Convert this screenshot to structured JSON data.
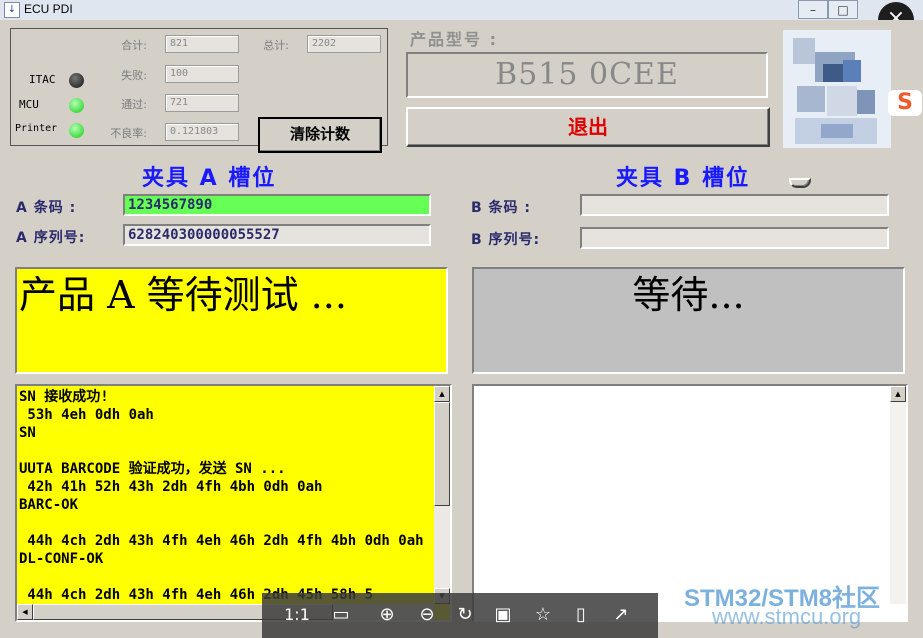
{
  "window": {
    "title": "ECU PDI",
    "close_glyph": "×"
  },
  "indicators": [
    {
      "label": "ITAC",
      "state": "off"
    },
    {
      "label": "MCU",
      "state": "on"
    },
    {
      "label": "Printer",
      "state": "on"
    }
  ],
  "counters": {
    "total_ok_label": "合计:",
    "total_ok_value": "821",
    "grand_total_label": "总计:",
    "grand_total_value": "2202",
    "fail_label": "失败:",
    "fail_value": "100",
    "pass_label": "通过:",
    "pass_value": "721",
    "defect_rate_label": "不良率:",
    "defect_rate_value": "0.121803",
    "clear_button": "清除计数"
  },
  "product": {
    "model_label": "产品型号 :",
    "model_value": "B515 0CEE",
    "exit_button": "退出"
  },
  "slot_a": {
    "title": "夹具 A 槽位",
    "barcode_label": "A  条码 :",
    "barcode_value": "1234567890",
    "serial_label": "A 序列号:",
    "serial_value": "628240300000055527",
    "status_text": "产品 A 等待测试 ...",
    "log": "SN 接收成功!\n 53h 4eh 0dh 0ah\nSN\n\nUUTA BARCODE 验证成功，发送 SN ...\n 42h 41h 52h 43h 2dh 4fh 4bh 0dh 0ah\nBARC-OK\n\n 44h 4ch 2dh 43h 4fh 4eh 46h 2dh 4fh 4bh 0dh 0ah\nDL-CONF-OK\n\n 44h 4ch 2dh 43h 4fh 4eh 46h 2dh 45h 58h 5"
  },
  "slot_b": {
    "title": "夹具 B 槽位",
    "barcode_label": "B  条码 :",
    "barcode_value": "",
    "serial_label": "B 序列号:",
    "serial_value": "",
    "status_text": "等待...",
    "log": ""
  },
  "viewer_toolbar": {
    "ratio_label": "1:1"
  },
  "watermark": {
    "line1": "STM32/STM8社区",
    "line2": "www.stmcu.org"
  },
  "colors": {
    "status_active": "#ffff00",
    "status_idle": "#c0c0c0",
    "barcode_ok": "#66ff55",
    "slot_title": "#1a1aff",
    "exit_text": "#e00000"
  }
}
